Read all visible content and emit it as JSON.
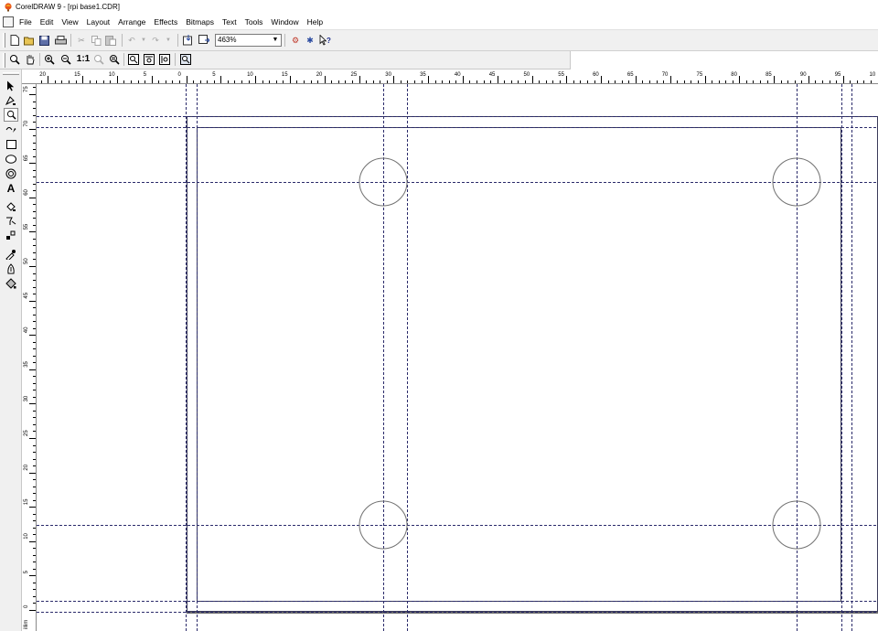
{
  "window": {
    "title": "CorelDRAW 9 - [rpi base1.CDR]"
  },
  "menu": [
    "File",
    "Edit",
    "View",
    "Layout",
    "Arrange",
    "Effects",
    "Bitmaps",
    "Text",
    "Tools",
    "Window",
    "Help"
  ],
  "standard_toolbar": {
    "buttons": [
      "new-icon",
      "open-icon",
      "save-icon",
      "print-icon",
      "cut-icon",
      "copy-icon",
      "paste-icon",
      "undo-icon",
      "redo-icon",
      "import-icon",
      "export-icon",
      "corel-tutor-icon",
      "application-launcher-icon",
      "whats-this-help-icon"
    ],
    "zoom_level": "463%"
  },
  "zoom_toolbar": {
    "buttons": [
      "zoom-tool-icon",
      "hand-tool-icon",
      "zoom-in-icon",
      "zoom-out-icon",
      "zoom-actual-size-icon",
      "zoom-to-selected-icon",
      "zoom-to-all-objects-icon",
      "zoom-to-page-icon",
      "zoom-to-page-width-icon",
      "zoom-to-page-height-icon",
      "zoom-one-shot-icon"
    ],
    "actual_size_label": "1:1"
  },
  "toolbox": [
    "pick-tool-icon",
    "shape-tool-icon",
    "zoom-tool-icon",
    "freehand-tool-icon",
    "rectangle-tool-icon",
    "ellipse-tool-icon",
    "polygon-tool-icon",
    "text-tool-icon",
    "interactive-fill-icon",
    "interactive-transparency-icon",
    "interactive-blend-icon",
    "eyedropper-tool-icon",
    "outline-tool-icon",
    "fill-tool-icon"
  ],
  "rulers": {
    "corner_label": "%",
    "horizontal_labels": [
      "20",
      "15",
      "10",
      "5",
      "0",
      "5",
      "10",
      "15",
      "20",
      "25",
      "30",
      "35",
      "40",
      "45",
      "50",
      "55",
      "60",
      "65",
      "70",
      "75",
      "80",
      "85",
      "90",
      "95",
      "10"
    ],
    "vertical_labels": [
      "75",
      "70",
      "65",
      "60",
      "55",
      "50",
      "45",
      "40",
      "35",
      "30",
      "25",
      "20",
      "15",
      "10",
      "5",
      "0"
    ],
    "vertical_unit_label": "illim"
  },
  "colors": {
    "ui_face": "#f0f0f0",
    "page_border": "#3c3c5a",
    "guide": "#2a2a6a",
    "circle": "#707070"
  }
}
